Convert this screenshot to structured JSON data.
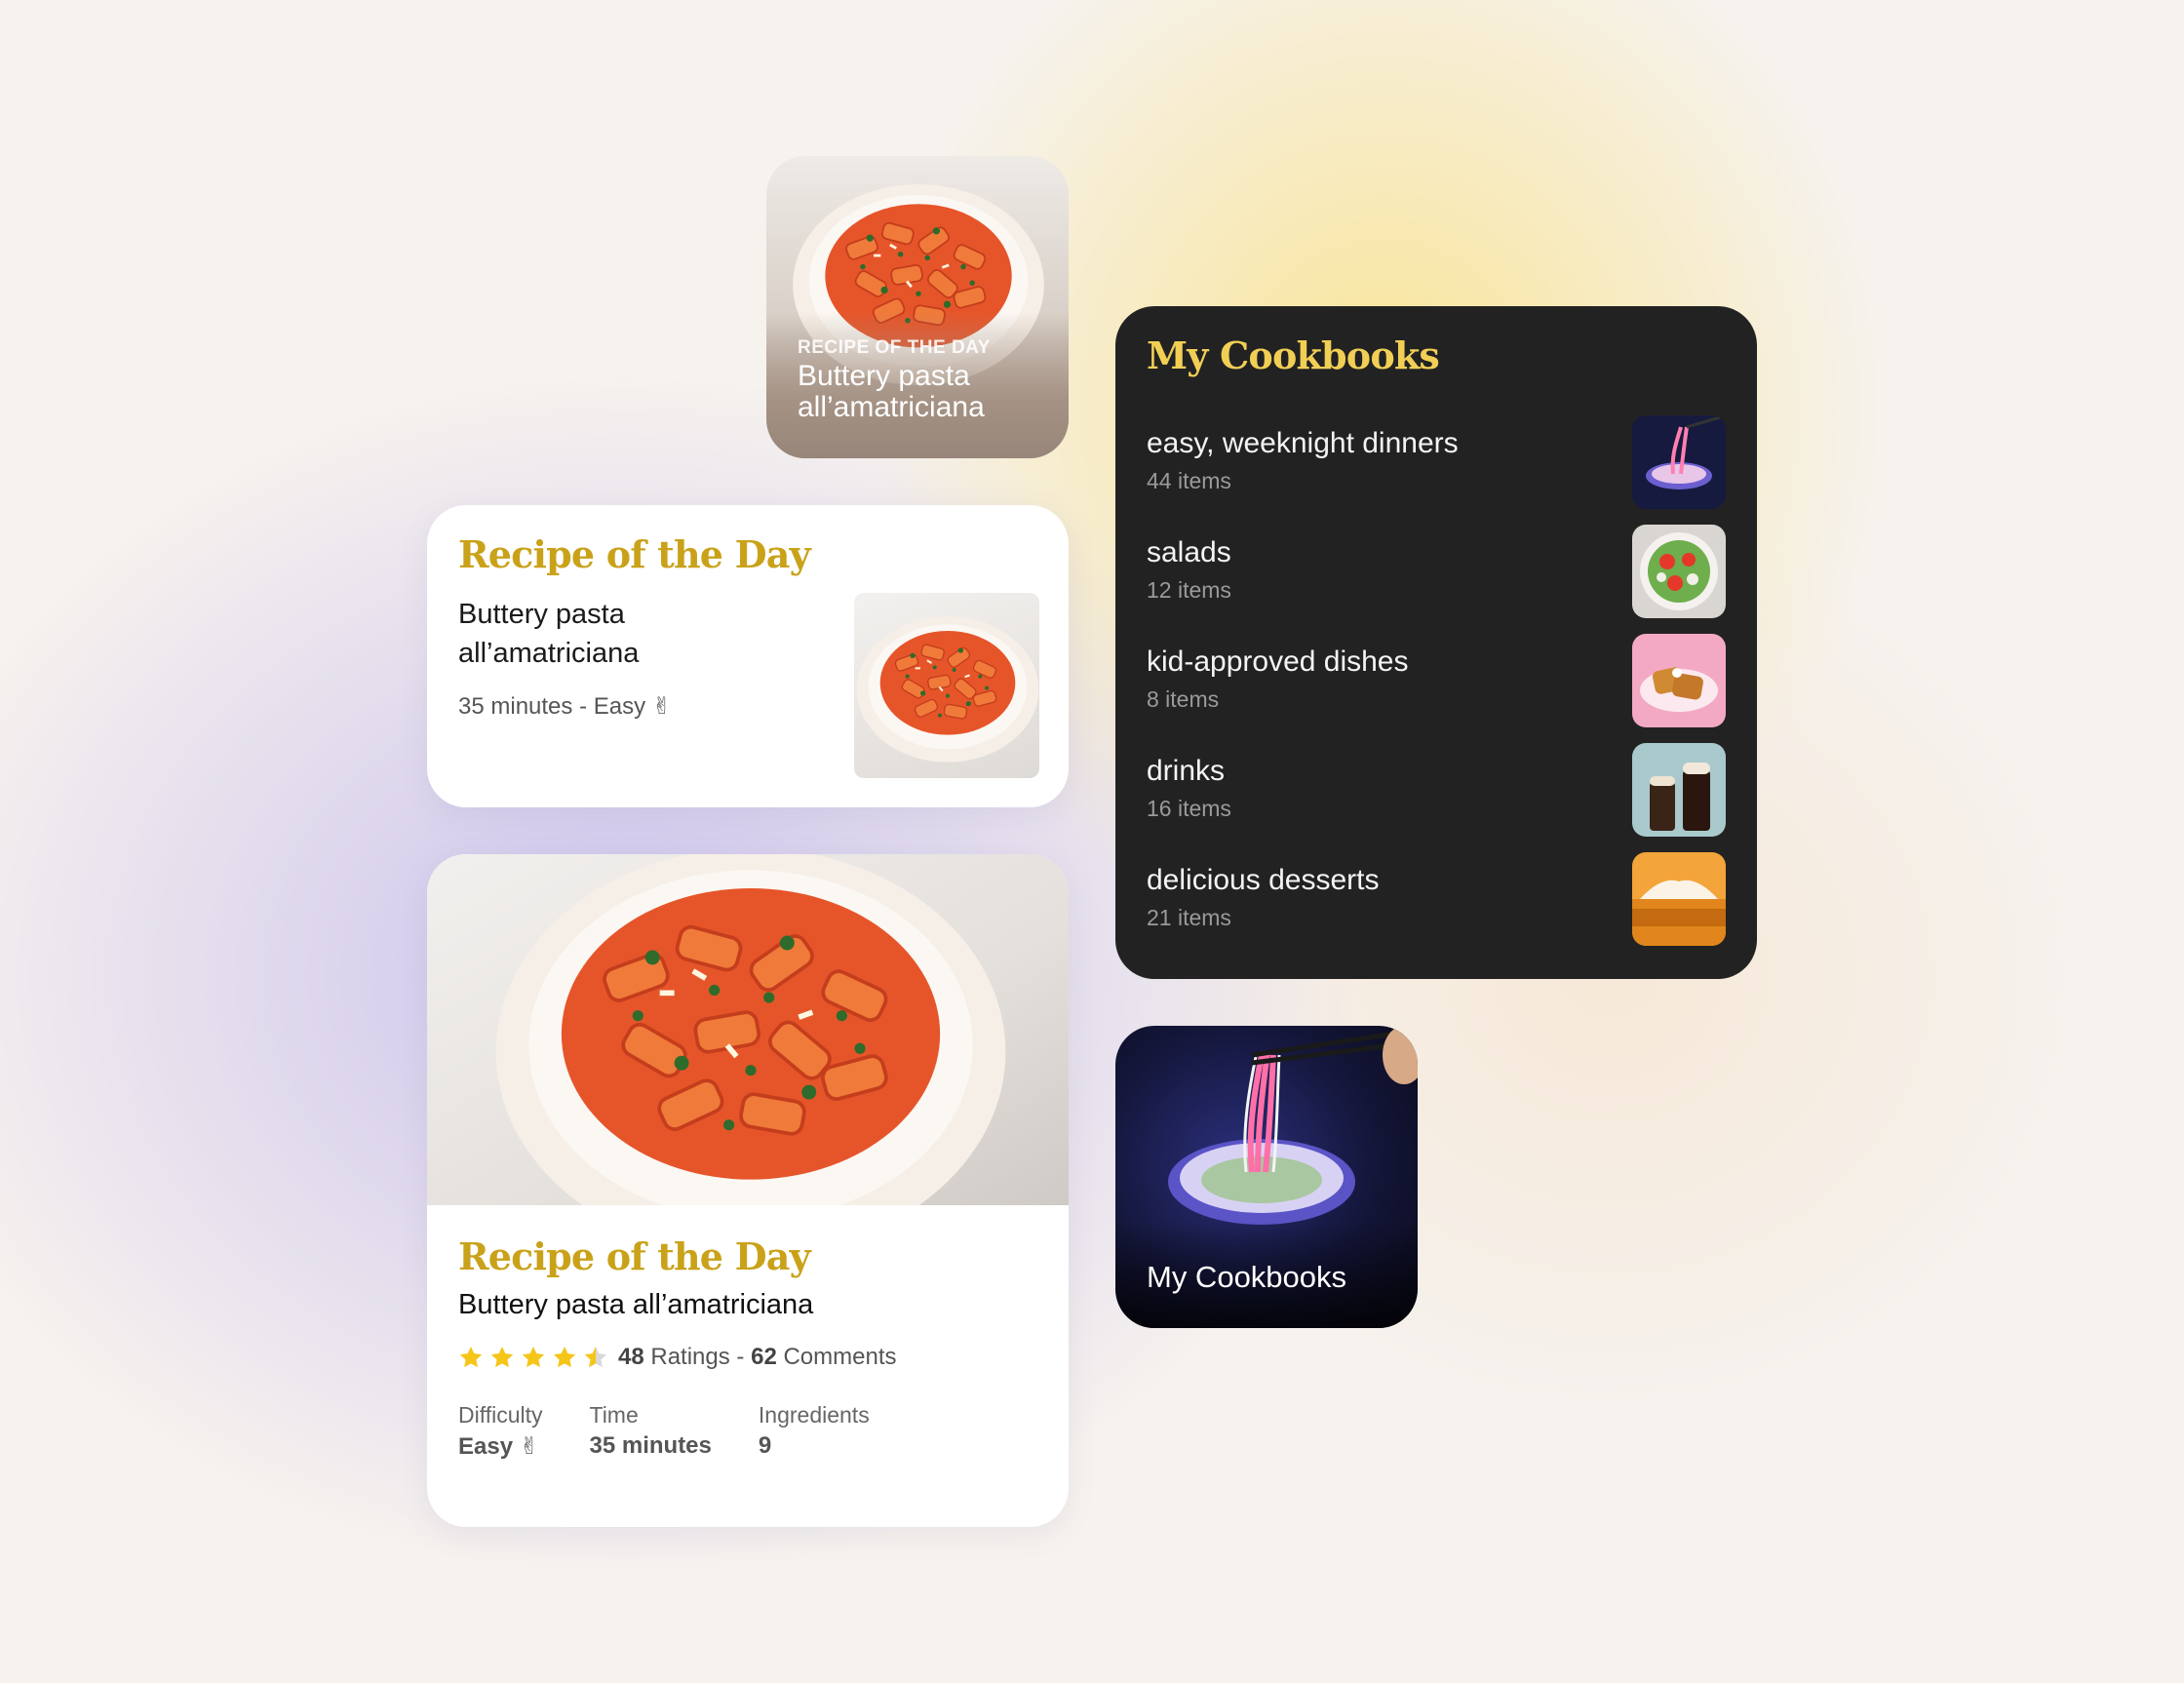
{
  "recipe": {
    "kicker": "RECIPE OF THE DAY",
    "section_title": "Recipe of the Day",
    "name_line1": "Buttery pasta",
    "name_line2": "all’amatriciana",
    "name_full": "Buttery pasta all’amatriciana",
    "meta": "35 minutes - Easy ✌",
    "rating_value": 4.5,
    "rating_max": 5,
    "ratings_count": "48",
    "ratings_label": "Ratings -",
    "comments_count": "62",
    "comments_label": "Comments",
    "stats": [
      {
        "label": "Difficulty",
        "value": "Easy ✌"
      },
      {
        "label": "Time",
        "value": "35 minutes"
      },
      {
        "label": "Ingredients",
        "value": "9"
      }
    ]
  },
  "cookbooks": {
    "title": "My Cookbooks",
    "items": [
      {
        "name": "easy, weeknight dinners",
        "count": "44 items",
        "thumb": "noodles-thumbnail"
      },
      {
        "name": "salads",
        "count": "12 items",
        "thumb": "salad-thumbnail"
      },
      {
        "name": "kid-approved dishes",
        "count": "8 items",
        "thumb": "french-toast-thumbnail"
      },
      {
        "name": "drinks",
        "count": "16 items",
        "thumb": "drinks-thumbnail"
      },
      {
        "name": "delicious desserts",
        "count": "21 items",
        "thumb": "dessert-thumbnail"
      }
    ]
  },
  "colors": {
    "accent_gold": "#c9a21a",
    "accent_gold_dark_bg": "#f1cf55",
    "star": "#f5c518",
    "dark_card": "#222222"
  }
}
